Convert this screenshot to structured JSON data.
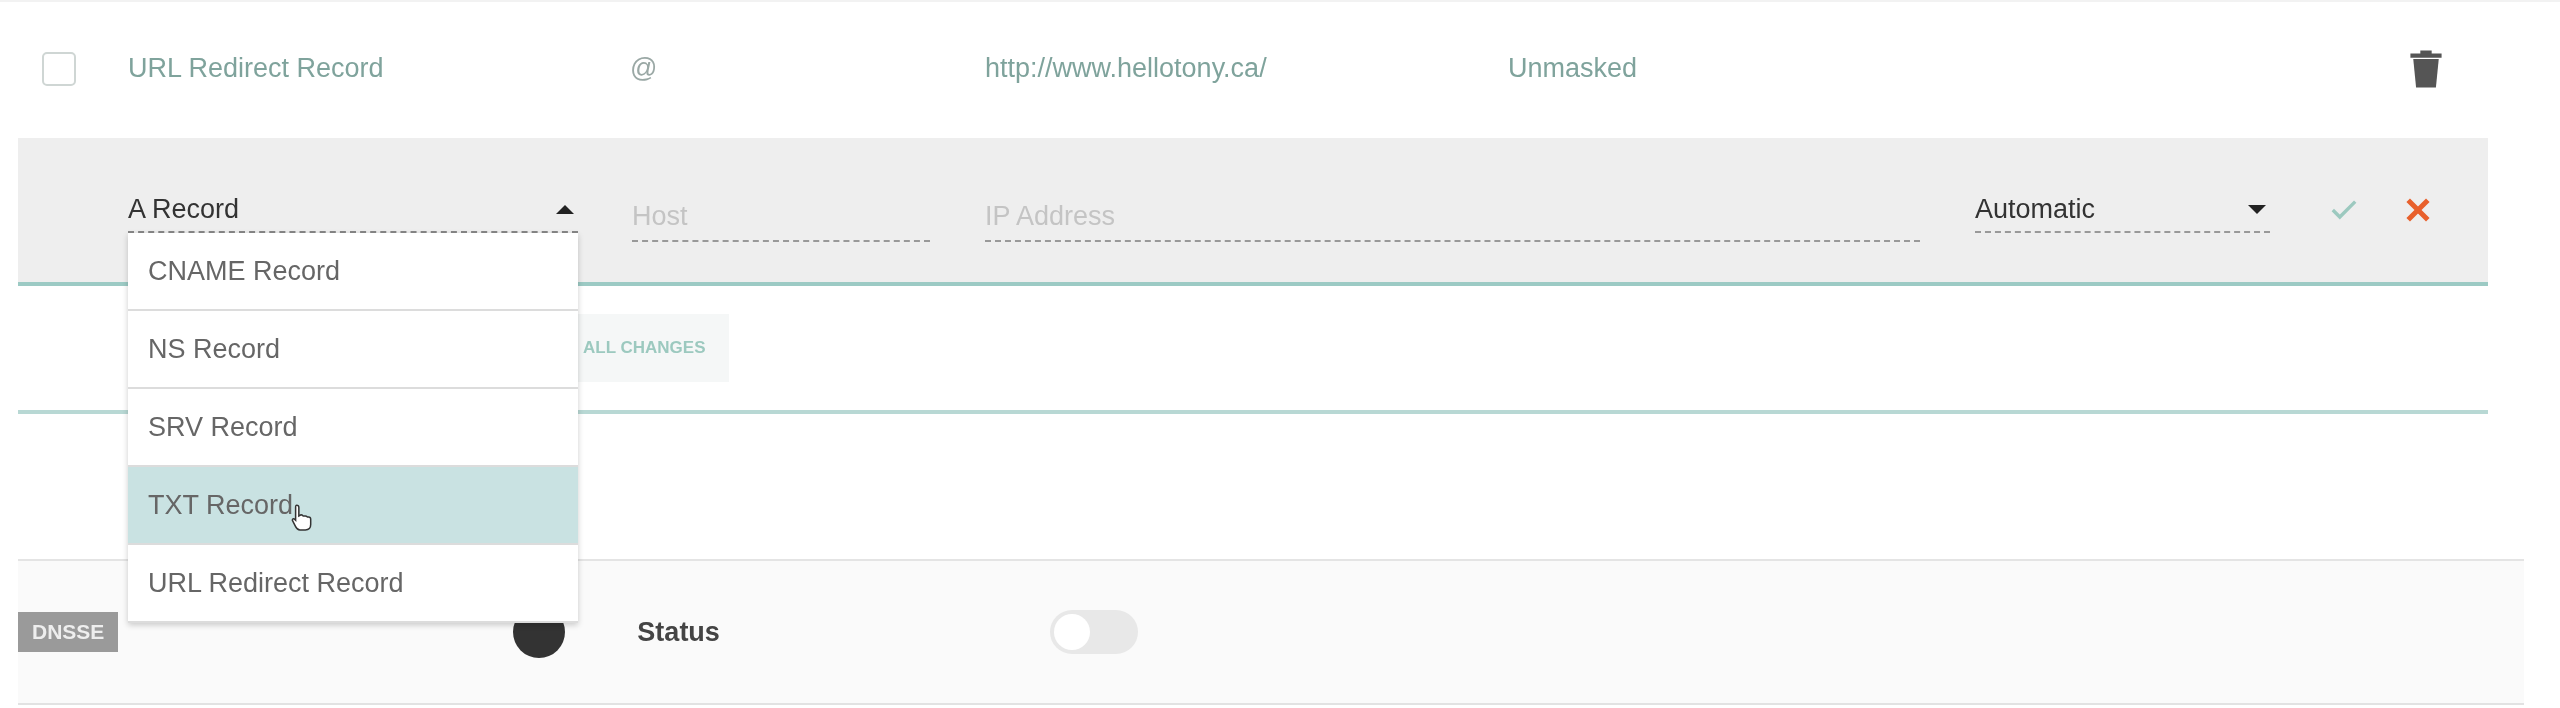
{
  "records": [
    {
      "type": "URL Redirect Record",
      "host": "@",
      "value": "http://www.hellotony.ca/",
      "mode": "Unmasked",
      "checked": false
    }
  ],
  "editor": {
    "type_select": {
      "value": "A Record",
      "expanded": true,
      "options": [
        {
          "label": "CNAME Record",
          "selected": false
        },
        {
          "label": "NS Record",
          "selected": false
        },
        {
          "label": "SRV Record",
          "selected": false
        },
        {
          "label": "TXT Record",
          "selected": true
        },
        {
          "label": "URL Redirect Record",
          "selected": false
        }
      ]
    },
    "host": {
      "placeholder": "Host"
    },
    "value": {
      "placeholder": "IP Address"
    },
    "ttl": {
      "value": "Automatic"
    }
  },
  "save_button": {
    "label": "ALL CHANGES"
  },
  "dnssec": {
    "tag": "DNSSE",
    "status_label": "Status",
    "status_on": false
  }
}
